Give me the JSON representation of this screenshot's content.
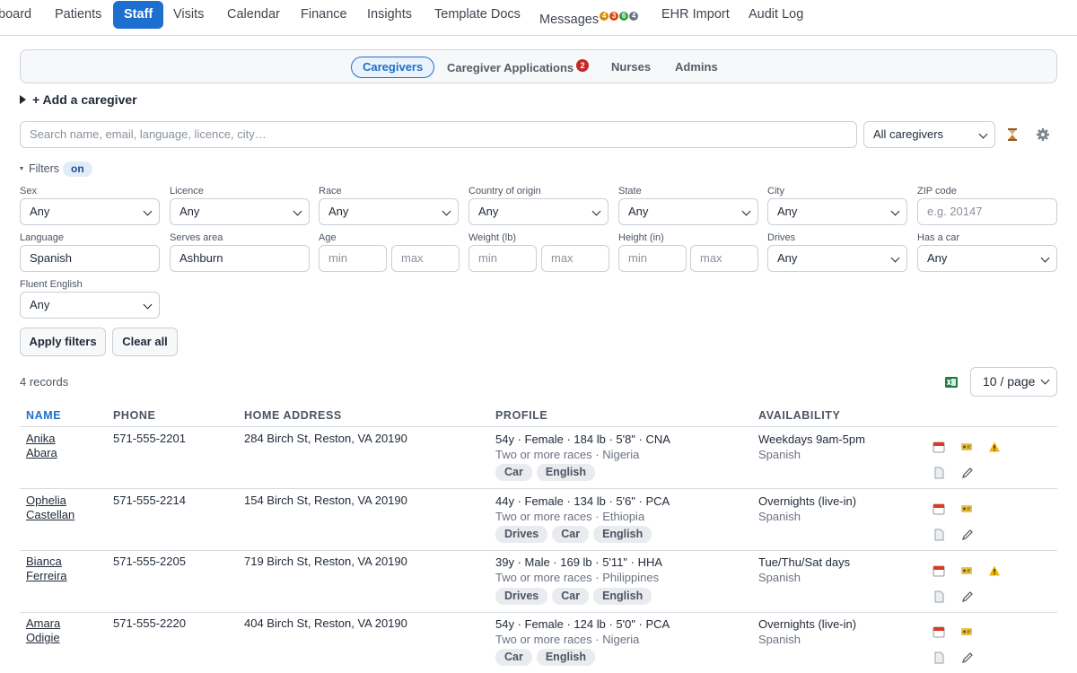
{
  "nav": {
    "items": [
      "board",
      "Patients",
      "Staff",
      "Visits",
      "Calendar",
      "Finance",
      "Insights",
      "Template Docs",
      "Messages",
      "EHR Import",
      "Audit Log"
    ],
    "messages_badges": [
      "4",
      "3",
      "6",
      "4"
    ],
    "badge_colors": [
      "#d98a00",
      "#d9480f",
      "#2f9e44",
      "#6b7280"
    ]
  },
  "subnav": {
    "tabs": [
      "Caregivers",
      "Caregiver Applications",
      "Nurses",
      "Admins"
    ],
    "applications_badge": "2"
  },
  "add_caregiver": "+ Add a caregiver",
  "search": {
    "placeholder": "Search name, email, language, licence, city…",
    "scope": "All caregivers"
  },
  "filters": {
    "toggle_label": "Filters",
    "state_pill": "on",
    "fields": {
      "sex": {
        "label": "Sex",
        "value": "Any"
      },
      "licence": {
        "label": "Licence",
        "value": "Any"
      },
      "race": {
        "label": "Race",
        "value": "Any"
      },
      "country": {
        "label": "Country of origin",
        "value": "Any"
      },
      "state": {
        "label": "State",
        "value": "Any"
      },
      "city": {
        "label": "City",
        "value": "Any"
      },
      "zip": {
        "label": "ZIP code",
        "placeholder": "e.g. 20147"
      },
      "language": {
        "label": "Language",
        "value": "Spanish"
      },
      "serves_area": {
        "label": "Serves area",
        "value": "Ashburn"
      },
      "age": {
        "label": "Age",
        "min": "min",
        "max": "max"
      },
      "weight": {
        "label": "Weight (lb)",
        "min": "min",
        "max": "max"
      },
      "height": {
        "label": "Height (in)",
        "min": "min",
        "max": "max"
      },
      "drives": {
        "label": "Drives",
        "value": "Any"
      },
      "has_car": {
        "label": "Has a car",
        "value": "Any"
      },
      "fluent_english": {
        "label": "Fluent English",
        "value": "Any"
      }
    },
    "apply_label": "Apply filters",
    "clear_label": "Clear all"
  },
  "records_count": "4 records",
  "page_size": "10 / page",
  "table": {
    "headers": [
      "NAME",
      "PHONE",
      "HOME ADDRESS",
      "PROFILE",
      "AVAILABILITY"
    ],
    "rows": [
      {
        "first": "Anika",
        "last": "Abara",
        "phone": "571-555-2201",
        "address": "284 Birch St, Reston, VA 20190",
        "profile": "54y · Female · 184 lb · 5'8\" · CNA",
        "origin": "Two or more races · Nigeria",
        "tags": [
          "Car",
          "English"
        ],
        "availability": "Weekdays 9am-5pm",
        "language": "Spanish",
        "warning": true
      },
      {
        "first": "Ophelia",
        "last": "Castellan",
        "phone": "571-555-2214",
        "address": "154 Birch St, Reston, VA 20190",
        "profile": "44y · Female · 134 lb · 5'6\" · PCA",
        "origin": "Two or more races · Ethiopia",
        "tags": [
          "Drives",
          "Car",
          "English"
        ],
        "availability": "Overnights (live-in)",
        "language": "Spanish",
        "warning": false
      },
      {
        "first": "Bianca",
        "last": "Ferreira",
        "phone": "571-555-2205",
        "address": "719 Birch St, Reston, VA 20190",
        "profile": "39y · Male · 169 lb · 5'11\" · HHA",
        "origin": "Two or more races · Philippines",
        "tags": [
          "Drives",
          "Car",
          "English"
        ],
        "availability": "Tue/Thu/Sat days",
        "language": "Spanish",
        "warning": true
      },
      {
        "first": "Amara",
        "last": "Odigie",
        "phone": "571-555-2220",
        "address": "404 Birch St, Reston, VA 20190",
        "profile": "54y · Female · 124 lb · 5'0\" · PCA",
        "origin": "Two or more races · Nigeria",
        "tags": [
          "Car",
          "English"
        ],
        "availability": "Overnights (live-in)",
        "language": "Spanish",
        "warning": false
      }
    ]
  },
  "colors": {
    "accent": "#1d6fcf",
    "warning": "#f2b600",
    "danger": "#c62828"
  }
}
